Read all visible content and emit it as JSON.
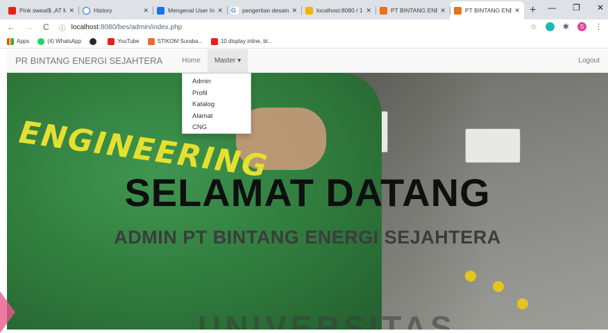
{
  "browser": {
    "tabs": [
      {
        "title": "Pink sweat$ ,AT M",
        "favicon_color": "#e62117"
      },
      {
        "title": "History",
        "favicon_color": "#1a73e8"
      },
      {
        "title": "Mengenal User Int",
        "favicon_color": "#1a73e8"
      },
      {
        "title": "pengertian desain",
        "favicon_color": "#4285f4"
      },
      {
        "title": "localhost:8080 / 1",
        "favicon_color": "#f4b400"
      },
      {
        "title": "PT BINTANG ENER",
        "favicon_color": "#e8711a"
      },
      {
        "title": "PT BINTANG ENER",
        "favicon_color": "#e8711a",
        "active": true
      }
    ],
    "url_host": "localhost",
    "url_rest": ":8080/bes/admin/index.php",
    "bookmarks": [
      "Apps",
      "(4) WhatsApp",
      "",
      "YouTube",
      "STIKOM Suraba...",
      "10 display inline, bl..."
    ],
    "profile_initial": "S"
  },
  "navbar": {
    "brand": "PR BINTANG ENERGI SEJAHTERA",
    "home": "Home",
    "master": "Master ▾",
    "logout": "Logout"
  },
  "dropdown": {
    "items": [
      "Admin",
      "Profil",
      "Katalog",
      "Alamat",
      "CNG"
    ]
  },
  "hero": {
    "jacket_text": "ENGINEERING",
    "title": "SELAMAT DATANG",
    "subtitle": "ADMIN PT BINTANG ENERGI SEJAHTERA",
    "watermark": "UNIVERSITAS"
  }
}
